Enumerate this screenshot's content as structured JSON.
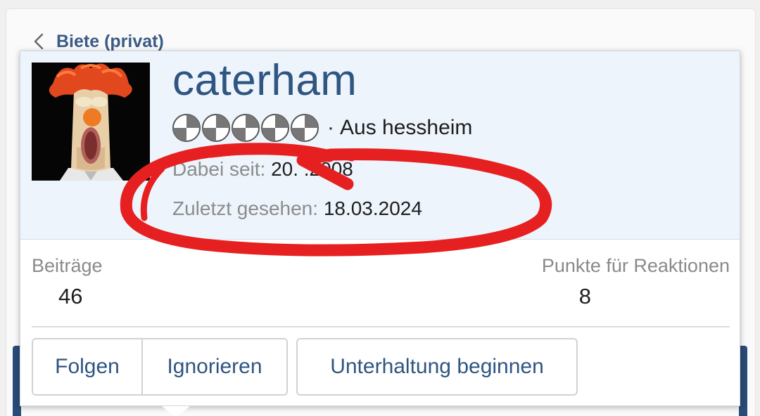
{
  "breadcrumb": {
    "label": "Biete (privat)"
  },
  "profile": {
    "username": "caterham",
    "rank_icon_count": 5,
    "separator": "·",
    "location": "Aus hessheim",
    "joined_label": "Dabei seit:",
    "joined_value": "20.  .2008",
    "last_seen_label": "Zuletzt gesehen:",
    "last_seen_value": "18.03.2024"
  },
  "stats": {
    "posts_label": "Beiträge",
    "posts_value": "46",
    "reactions_label": "Punkte für Reaktionen",
    "reactions_value": "8"
  },
  "actions": {
    "follow": "Folgen",
    "ignore": "Ignorieren",
    "start_conversation": "Unterhaltung beginnen"
  },
  "colors": {
    "accent": "#2f5581",
    "header_bg": "#edf4fc",
    "annotation": "#e62020"
  }
}
